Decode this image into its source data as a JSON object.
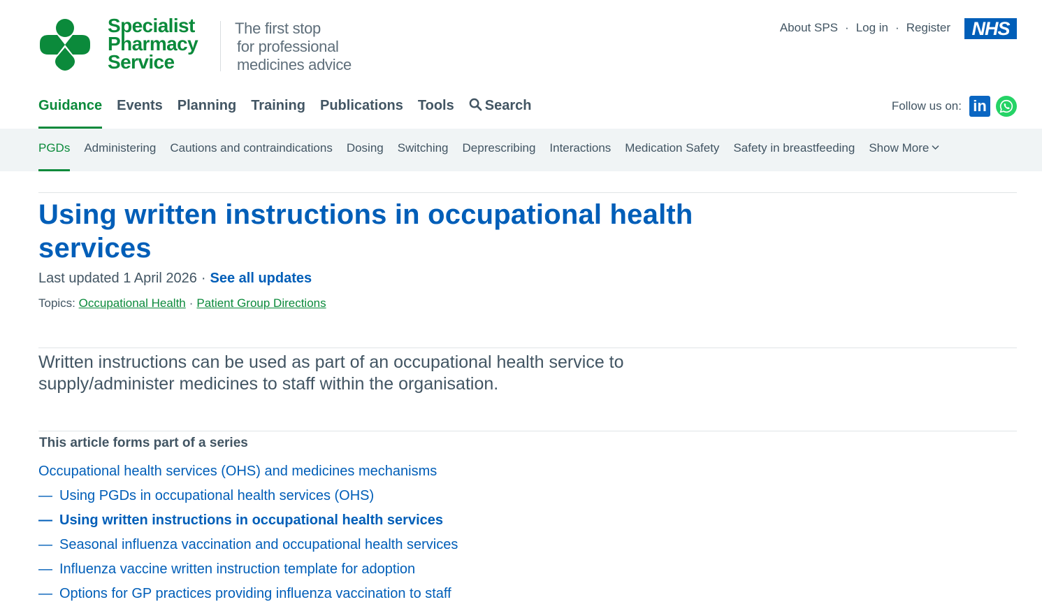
{
  "brand": {
    "line1": "Specialist",
    "line2": "Pharmacy",
    "line3": "Service",
    "tagline1": "The first stop",
    "tagline2": "for professional",
    "tagline3": "medicines advice",
    "color": "#0b8a3b"
  },
  "util_nav": {
    "about": "About SPS",
    "login": "Log in",
    "register": "Register",
    "sep": "·",
    "nhs": "NHS"
  },
  "main_nav": {
    "items": [
      "Guidance",
      "Events",
      "Planning",
      "Training",
      "Publications",
      "Tools"
    ],
    "search": "Search",
    "active": "Guidance"
  },
  "follow": {
    "label": "Follow us on:",
    "linkedin": "in",
    "icons": [
      "linkedin-icon",
      "whatsapp-icon"
    ]
  },
  "sub_nav": {
    "items": [
      "PGDs",
      "Administering",
      "Cautions and contraindications",
      "Dosing",
      "Switching",
      "Deprescribing",
      "Interactions",
      "Medication Safety",
      "Safety in breastfeeding"
    ],
    "more": "Show More",
    "active": "PGDs"
  },
  "article": {
    "title": "Using written instructions in occupational health services",
    "updated_label": "Last updated 1 April 2026",
    "dot": "·",
    "see_all": "See all updates",
    "topics_label": "Topics:",
    "topics": [
      "Occupational Health",
      "Patient Group Directions"
    ],
    "lede": "Written instructions can be used as part of an occupational health service to supply/administer medicines to staff within the organisation."
  },
  "series": {
    "heading": "This article forms part of a series",
    "parent": "Occupational health services (OHS) and medicines mechanisms",
    "dash": "—",
    "children": [
      "Using PGDs in occupational health services (OHS)",
      "Using written instructions in occupational health services",
      "Seasonal influenza vaccination and occupational health services",
      "Influenza vaccine written instruction template for adoption",
      "Options for GP practices providing influenza vaccination to staff"
    ],
    "current_index": 1
  },
  "colors": {
    "link_blue": "#005eb8",
    "green": "#0b8a3b",
    "text": "#425563",
    "subnav_bg": "#f0f4f5"
  }
}
